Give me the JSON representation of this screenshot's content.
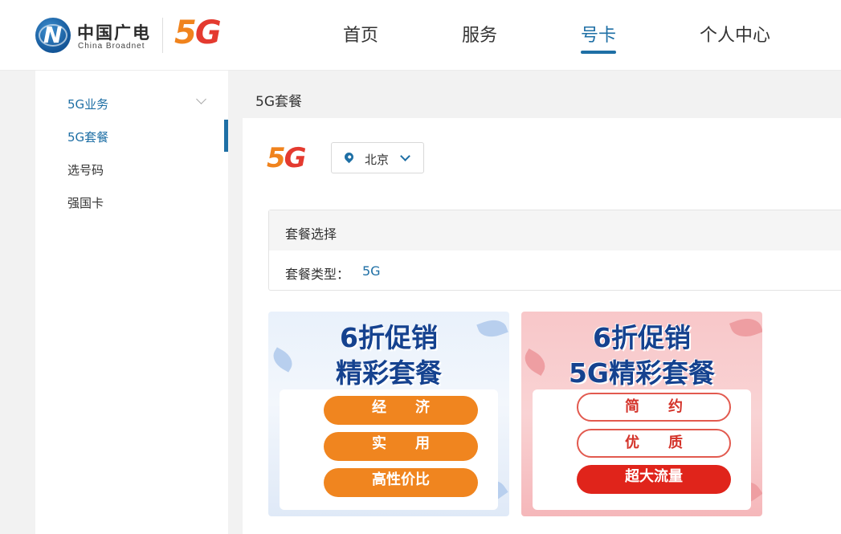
{
  "header": {
    "brand_cn": "中国广电",
    "brand_en": "China Broadnet",
    "logo_5g": "5G",
    "nav": [
      {
        "label": "首页",
        "active": false
      },
      {
        "label": "服务",
        "active": false
      },
      {
        "label": "号卡",
        "active": true
      },
      {
        "label": "个人中心",
        "active": false
      }
    ]
  },
  "sidebar": {
    "items": [
      {
        "label": "5G业务",
        "expandable": true
      },
      {
        "label": "5G套餐",
        "selected": true
      },
      {
        "label": "选号码"
      },
      {
        "label": "强国卡"
      }
    ]
  },
  "breadcrumb": "5G套餐",
  "main": {
    "logo_5g": "5G",
    "city": "北京",
    "filter": {
      "title": "套餐选择",
      "type_label": "套餐类型：",
      "type_value": "5G"
    },
    "cards": [
      {
        "line1": "6折促销",
        "line2": "精彩套餐",
        "pills": [
          "经　　济",
          "实　　用",
          "高性价比"
        ]
      },
      {
        "line1": "6折促销",
        "line2": "5G精彩套餐",
        "pills": [
          "简　　约",
          "优　　质",
          "超大流量"
        ]
      }
    ]
  },
  "colors": {
    "accent_blue": "#1e6fa5",
    "brand_orange": "#f0831d",
    "brand_red": "#e43a2f",
    "card_title": "#15428f",
    "pill_orange": "#f0851f",
    "pill_red": "#e0241b"
  }
}
